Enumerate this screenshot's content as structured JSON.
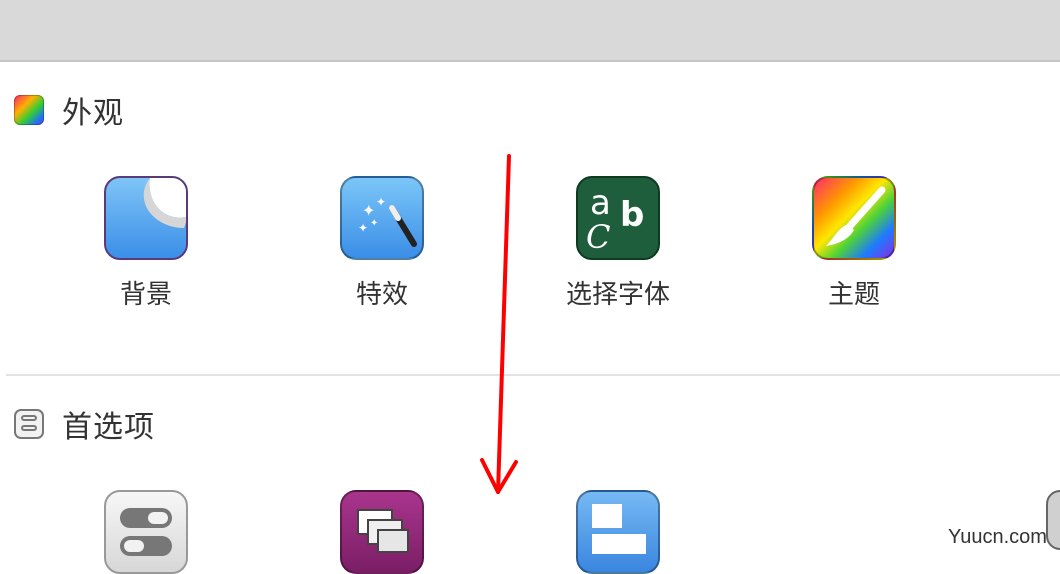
{
  "sections": [
    {
      "title": "外观",
      "items": [
        {
          "label": "背景",
          "icon": "background-page-icon"
        },
        {
          "label": "特效",
          "icon": "magic-wand-icon"
        },
        {
          "label": "选择字体",
          "icon": "font-abc-icon"
        },
        {
          "label": "主题",
          "icon": "paintbrush-icon"
        }
      ]
    },
    {
      "title": "首选项",
      "items": [
        {
          "label": "",
          "icon": "toggles-icon"
        },
        {
          "label": "",
          "icon": "windows-stack-icon"
        },
        {
          "label": "",
          "icon": "layout-panels-icon"
        }
      ]
    }
  ],
  "font_icon_letters": {
    "a": "a",
    "b": "b",
    "c": "C"
  },
  "watermark": "Yuucn.com",
  "colors": {
    "annotation_arrow": "#ff0000",
    "font_icon_bg": "#1f5e3c",
    "windows_icon_bg": "#9b2d80"
  }
}
